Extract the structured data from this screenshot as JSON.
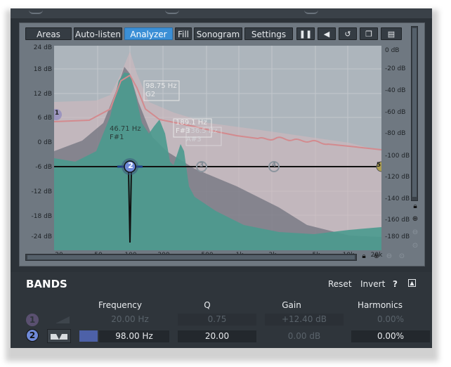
{
  "toolbar": {
    "buttons": [
      {
        "label": "Areas",
        "active": false
      },
      {
        "label": "Auto-listen",
        "active": false
      },
      {
        "label": "Analyzer",
        "active": true
      },
      {
        "label": "Fill",
        "active": false
      },
      {
        "label": "Sonogram",
        "active": false
      },
      {
        "label": "Settings",
        "active": false
      }
    ],
    "icons": [
      "pause-icon",
      "monitor-icon",
      "undo-icon",
      "copy-icon",
      "paste-icon"
    ]
  },
  "plot": {
    "left_gain_labels": [
      "24 dB",
      "18 dB",
      "12 dB",
      "6 dB",
      "0 dB",
      "-6 dB",
      "-12 dB",
      "-18 dB",
      "-24 dB"
    ],
    "right_db_labels": [
      "0 dB",
      "-20 dB",
      "-40 dB",
      "-60 dB",
      "-80 dB",
      "-100 dB",
      "-120 dB",
      "-140 dB",
      "-160 dB",
      "-180 dB"
    ],
    "freq_labels": [
      "20",
      "50",
      "100",
      "200",
      "500",
      "1k",
      "2k",
      "5k",
      "10k",
      "20k"
    ],
    "peak_labels": [
      {
        "freq": "98.75 Hz",
        "note": "G2"
      },
      {
        "freq": "46.71 Hz",
        "note": "F#1"
      },
      {
        "freq": "189.1 Hz",
        "note": "F#3"
      },
      {
        "freq": "236.5 Hz",
        "note": "A#3"
      }
    ],
    "band_nodes": [
      "1",
      "2",
      "3",
      "4",
      "5"
    ]
  },
  "bands": {
    "title": "BANDS",
    "reset_label": "Reset",
    "invert_label": "Invert",
    "help_label": "?",
    "columns": [
      "Frequency",
      "Q",
      "Gain",
      "Harmonics"
    ],
    "rows": [
      {
        "num": "1",
        "frequency": "20.00 Hz",
        "q": "0.75",
        "gain": "+12.40 dB",
        "harmonics": "0.00%",
        "active": false
      },
      {
        "num": "2",
        "frequency": "98.00 Hz",
        "q": "20.00",
        "gain": "0.00 dB",
        "harmonics": "0.00%",
        "active": true
      }
    ]
  }
}
